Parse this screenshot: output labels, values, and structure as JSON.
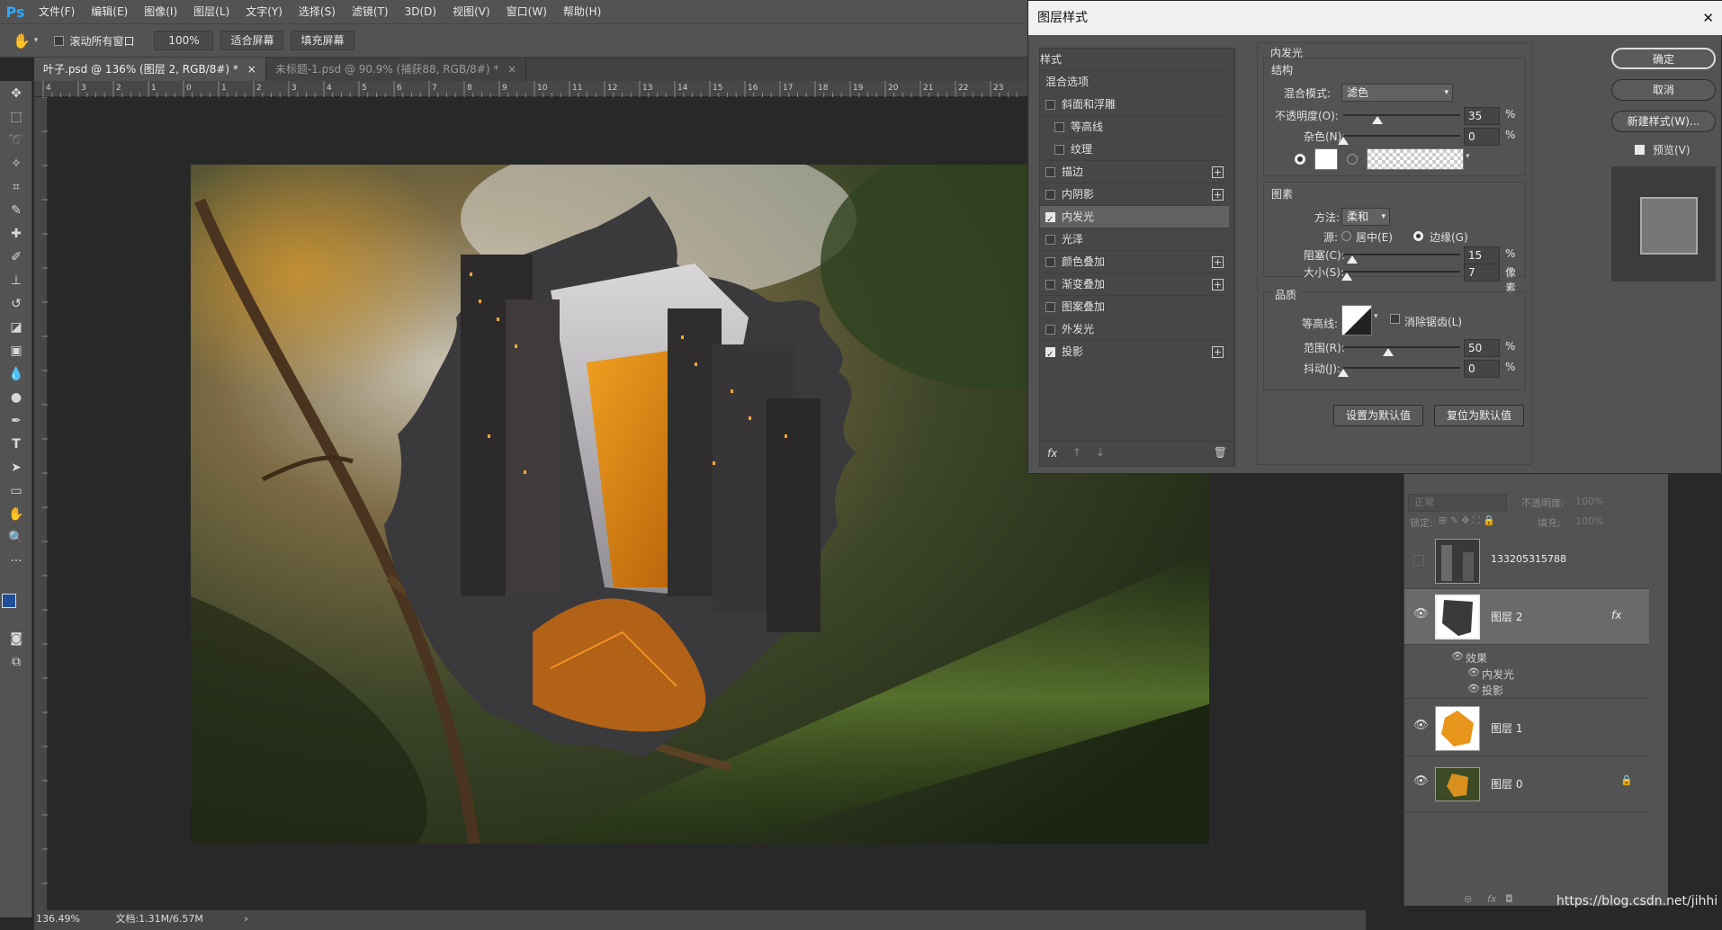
{
  "app": {
    "logo": "Ps"
  },
  "menu": [
    "文件(F)",
    "编辑(E)",
    "图像(I)",
    "图层(L)",
    "文字(Y)",
    "选择(S)",
    "滤镜(T)",
    "3D(D)",
    "视图(V)",
    "窗口(W)",
    "帮助(H)"
  ],
  "options": {
    "scroll_all": "滚动所有窗口",
    "zoom": "100%",
    "fit_screen": "适合屏幕",
    "fill_screen": "填充屏幕"
  },
  "tabs": [
    {
      "label": "叶子.psd @ 136% (图层 2, RGB/8#) *",
      "close": "×"
    },
    {
      "label": "未标题-1.psd @ 90.9% (捕获88, RGB/8#) *",
      "close": "×"
    }
  ],
  "ruler": [
    "4",
    "3",
    "2",
    "1",
    "0",
    "1",
    "2",
    "3",
    "4",
    "5",
    "6",
    "7",
    "8",
    "9",
    "10",
    "11",
    "12",
    "13",
    "14",
    "15",
    "16",
    "17",
    "18",
    "19",
    "20",
    "21",
    "22",
    "23"
  ],
  "status": {
    "zoom": "136.49%",
    "doc": "文档:1.31M/6.57M",
    "arrow": "›"
  },
  "dialog": {
    "title": "图层样式",
    "close": "✕",
    "styles_header": "样式",
    "blend_options": "混合选项",
    "items": [
      {
        "label": "斜面和浮雕",
        "checked": false,
        "plus": false
      },
      {
        "label": "等高线",
        "checked": false,
        "plus": false
      },
      {
        "label": "纹理",
        "checked": false,
        "plus": false
      },
      {
        "label": "描边",
        "checked": false,
        "plus": true
      },
      {
        "label": "内阴影",
        "checked": false,
        "plus": true
      },
      {
        "label": "内发光",
        "checked": true,
        "plus": false
      },
      {
        "label": "光泽",
        "checked": false,
        "plus": false
      },
      {
        "label": "颜色叠加",
        "checked": false,
        "plus": true
      },
      {
        "label": "渐变叠加",
        "checked": false,
        "plus": true
      },
      {
        "label": "图案叠加",
        "checked": false,
        "plus": false
      },
      {
        "label": "外发光",
        "checked": false,
        "plus": false
      },
      {
        "label": "投影",
        "checked": true,
        "plus": true
      }
    ],
    "panel_title": "内发光",
    "structure": {
      "title": "结构",
      "blend_label": "混合模式:",
      "blend_value": "滤色",
      "opacity_label": "不透明度(O):",
      "opacity": "35",
      "noise_label": "杂色(N):",
      "noise": "0",
      "pct": "%"
    },
    "elements": {
      "title": "图素",
      "method_label": "方法:",
      "method_value": "柔和",
      "source_label": "源:",
      "center": "居中(E)",
      "edge": "边缘(G)",
      "choke_label": "阻塞(C):",
      "choke": "15",
      "size_label": "大小(S):",
      "size": "7",
      "px": "像素"
    },
    "quality": {
      "title": "品质",
      "contour_label": "等高线:",
      "antialias": "消除锯齿(L)",
      "range_label": "范围(R):",
      "range": "50",
      "jitter_label": "抖动(J):",
      "jitter": "0"
    },
    "make_default": "设置为默认值",
    "reset_default": "复位为默认值",
    "ok": "确定",
    "cancel": "取消",
    "new_style": "新建样式(W)...",
    "preview": "预览(V)",
    "fx": "fx"
  },
  "layers": {
    "mode": "正常",
    "opacity_label": "不透明度:",
    "opacity": "100%",
    "lock_label": "锁定:",
    "fill_label": "填充:",
    "fill": "100%",
    "rows": [
      {
        "name": "133205315788",
        "visible": false
      },
      {
        "name": "图层 2",
        "visible": true
      },
      {
        "name": "图层 1",
        "visible": true
      },
      {
        "name": "图层 0",
        "visible": true
      }
    ],
    "effects_label": "效果",
    "effect1": "内发光",
    "effect2": "投影",
    "watermark": "https://blog.csdn.net/jihhi"
  }
}
